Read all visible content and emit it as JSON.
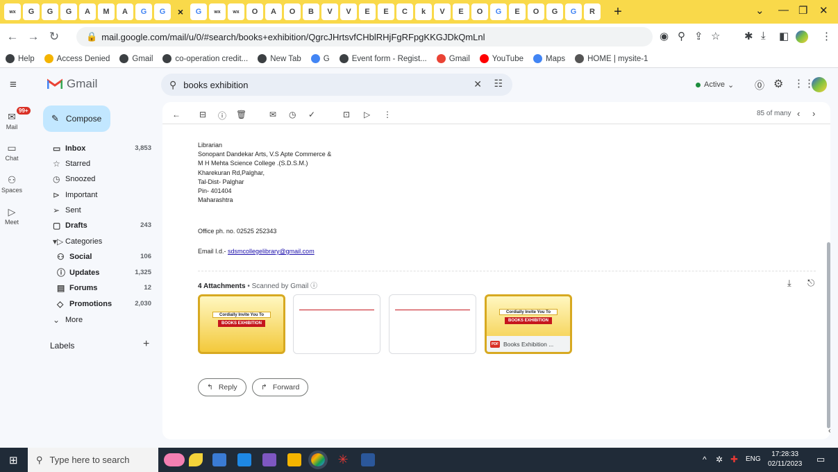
{
  "browser": {
    "url": "mail.google.com/mail/u/0/#search/books+exhibition/QgrcJHrtsvfCHblRHjFgRFpgKKGJDkQmLnl",
    "tabs": [
      "wx",
      "G",
      "G",
      "G",
      "A",
      "M",
      "A",
      "G",
      "G",
      "×",
      "G",
      "wx",
      "wx",
      "O",
      "A",
      "O",
      "B",
      "V",
      "V",
      "E",
      "E",
      "C",
      "k",
      "V",
      "E",
      "O",
      "G",
      "E",
      "O",
      "G",
      "G",
      "R"
    ],
    "new_tab": "+",
    "bookmarks": [
      "Help",
      "Access Denied",
      "Gmail",
      "co-operation credit...",
      "New Tab",
      "G",
      "Event form - Regist...",
      "Gmail",
      "YouTube",
      "Maps",
      "HOME | mysite-1"
    ]
  },
  "gmail": {
    "logo": "Gmail",
    "search_value": "books exhibition",
    "status": "Active",
    "compose": "Compose",
    "rail": [
      "Mail",
      "Chat",
      "Spaces",
      "Meet"
    ],
    "mail_badge": "99+",
    "nav": [
      {
        "label": "Inbox",
        "count": "3,853",
        "bold": true,
        "icon": "inbox-icon"
      },
      {
        "label": "Starred",
        "count": "",
        "bold": false,
        "icon": "star-icon"
      },
      {
        "label": "Snoozed",
        "count": "",
        "bold": false,
        "icon": "clock-icon"
      },
      {
        "label": "Important",
        "count": "",
        "bold": false,
        "icon": "important-icon"
      },
      {
        "label": "Sent",
        "count": "",
        "bold": false,
        "icon": "sent-icon"
      },
      {
        "label": "Drafts",
        "count": "243",
        "bold": true,
        "icon": "draft-icon"
      },
      {
        "label": "Categories",
        "count": "",
        "bold": false,
        "icon": "label-icon"
      },
      {
        "label": "Social",
        "count": "106",
        "bold": true,
        "icon": "people-icon"
      },
      {
        "label": "Updates",
        "count": "1,325",
        "bold": true,
        "icon": "info-icon"
      },
      {
        "label": "Forums",
        "count": "12",
        "bold": true,
        "icon": "forum-icon"
      },
      {
        "label": "Promotions",
        "count": "2,030",
        "bold": true,
        "icon": "tag-icon"
      },
      {
        "label": "More",
        "count": "",
        "bold": false,
        "icon": "chevron-down-icon"
      }
    ],
    "labels_heading": "Labels",
    "pager": "85 of many",
    "signature": [
      "Librarian",
      "Sonopant Dandekar Arts, V.S Apte Commerce &",
      "M H Mehta Science College .(S.D.S.M.)",
      "Kharekuran Rd,Palghar,",
      "Tal-Dist- Palghar",
      "Pin- 401404",
      "Maharashtra"
    ],
    "office_phone": "Office ph. no. 02525 252343",
    "email_label": "Email I.d.- ",
    "email_link": "sdsmcollegelibrary@gmail.com",
    "attachments_title": "4 Attachments",
    "scanned": " • Scanned by Gmail ⓘ",
    "attachment_name": "Books Exhibition ...",
    "pdf_badge": "PDF",
    "poster_text": [
      "Cordially Invite You To",
      "BOOKS EXHIBITION"
    ],
    "reply": "Reply",
    "forward": "Forward"
  },
  "taskbar": {
    "search_placeholder": "Type here to search",
    "lang": "ENG",
    "time": "17:28:33",
    "date": "02/11/2023"
  }
}
